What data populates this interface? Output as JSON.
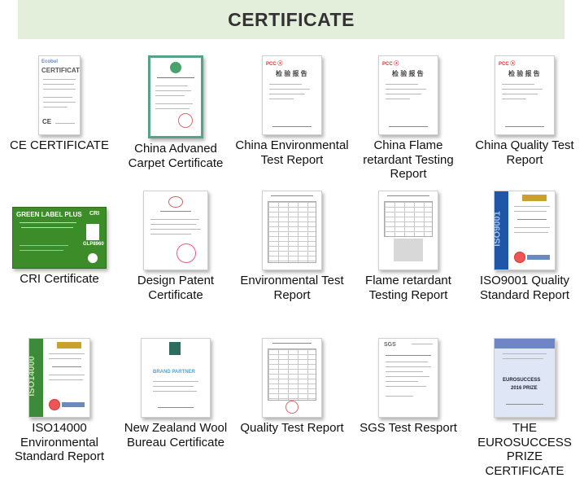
{
  "header": {
    "title": "CERTIFICATE"
  },
  "certificates": [
    {
      "label": "CE CERTIFICATE",
      "icon": "ce-certificate-icon"
    },
    {
      "label": "China Advaned Carpet Certificate",
      "icon": "china-carpet-certificate-icon"
    },
    {
      "label": "China Environmental Test Report",
      "icon": "environmental-report-icon"
    },
    {
      "label": "China Flame retardant Testing Report",
      "icon": "flame-report-icon"
    },
    {
      "label": "China Quality Test Report",
      "icon": "quality-report-icon"
    },
    {
      "label": "CRI Certificate",
      "icon": "cri-certificate-icon"
    },
    {
      "label": "Design Patent Certificate",
      "icon": "design-patent-icon"
    },
    {
      "label": "Environmental Test Report",
      "icon": "environmental-table-icon"
    },
    {
      "label": "Flame retardant Testing Report",
      "icon": "flame-table-icon"
    },
    {
      "label": "ISO9001 Quality Standard Report",
      "icon": "iso9001-icon"
    },
    {
      "label": "ISO14000 Environmental Standard Report",
      "icon": "iso14000-icon"
    },
    {
      "label": "New Zealand Wool Bureau Certificate",
      "icon": "wool-bureau-icon"
    },
    {
      "label": "Quality Test Report",
      "icon": "quality-table-icon"
    },
    {
      "label": "SGS Test Resport",
      "icon": "sgs-report-icon"
    },
    {
      "label": "THE EUROSUCCESS PRIZE CERTIFICATE",
      "icon": "eurosuccess-icon"
    }
  ],
  "thumbs": {
    "ce": {
      "brand": "Ecobul",
      "title": "CERTIFICATE",
      "mark": "CE"
    },
    "cri": {
      "banner": "GREEN LABEL PLUS",
      "logo": "CRI",
      "id": "GLP8960"
    },
    "iso9001": {
      "side": "ISO9001"
    },
    "iso14000": {
      "side": "ISO14000"
    },
    "wool": {
      "text": "BRAND PARTNER"
    },
    "sgs": {
      "brand": "SGS"
    },
    "euro": {
      "title": "EUROSUCCESS",
      "year": "2016 PRIZE"
    },
    "china_report": {
      "title": "检 验 报 告"
    }
  },
  "colors": {
    "banner_bg": "#e4efdb",
    "cri_green": "#3d8c2a",
    "iso_blue": "#1f56a8",
    "euro_blue": "#6f86c6"
  }
}
